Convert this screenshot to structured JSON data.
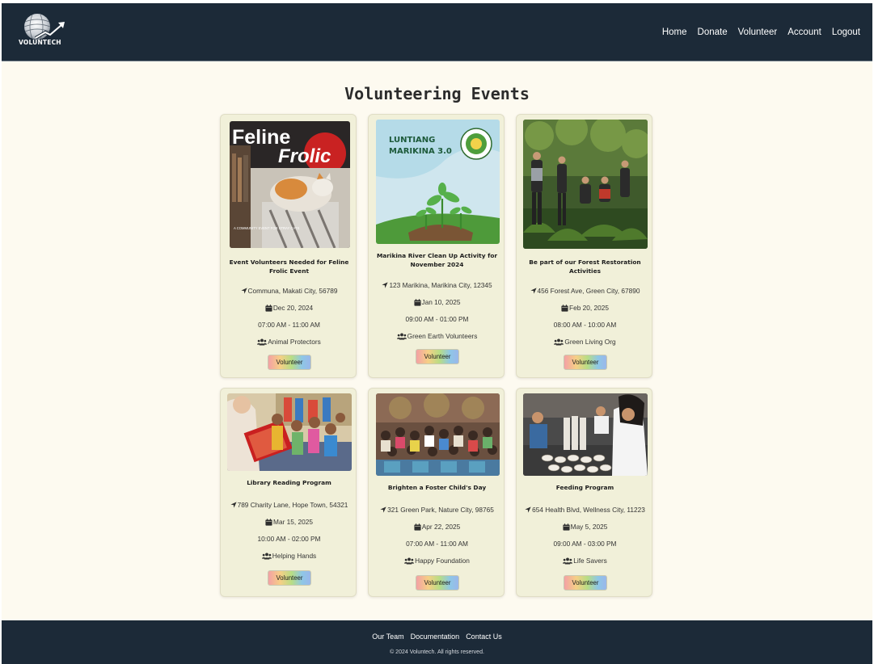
{
  "brand": {
    "logo_text": "VOLUNTECH"
  },
  "nav": {
    "items": [
      {
        "label": "Home"
      },
      {
        "label": "Donate"
      },
      {
        "label": "Volunteer"
      },
      {
        "label": "Account"
      },
      {
        "label": "Logout"
      }
    ]
  },
  "page": {
    "title": "Volunteering Events"
  },
  "events": [
    {
      "image_title_line1": "Feline",
      "image_title_line2": "Frolic",
      "image_caption": "A COMMUNITY EVENT FOR STRAY CATS",
      "title": "Event Volunteers Needed for Feline Frolic Event",
      "location": "Communa, Makati City, 56789",
      "date": "Dec 20, 2024",
      "time": "07:00 AM - 11:00 AM",
      "organizer": "Animal Protectors",
      "button_label": "Volunteer"
    },
    {
      "image_title_line1": "LUNTIANG",
      "image_title_line2": "MARIKINA 3.0",
      "title": "Marikina River Clean Up Activity for November 2024",
      "location": "123 Marikina, Marikina City, 12345",
      "date": "Jan 10, 2025",
      "time": "09:00 AM - 01:00 PM",
      "organizer": "Green Earth Volunteers",
      "button_label": "Volunteer"
    },
    {
      "title": "Be part of our Forest Restoration Activities",
      "location": "456 Forest Ave, Green City, 67890",
      "date": "Feb 20, 2025",
      "time": "08:00 AM - 10:00 AM",
      "organizer": "Green Living Org",
      "button_label": "Volunteer"
    },
    {
      "title": "Library Reading Program",
      "location": "789 Charity Lane, Hope Town, 54321",
      "date": "Mar 15, 2025",
      "time": "10:00 AM - 02:00 PM",
      "organizer": "Helping Hands",
      "button_label": "Volunteer"
    },
    {
      "title": "Brighten a Foster Child's Day",
      "location": "321 Green Park, Nature City, 98765",
      "date": "Apr 22, 2025",
      "time": "07:00 AM - 11:00 AM",
      "organizer": "Happy Foundation",
      "button_label": "Volunteer"
    },
    {
      "title": "Feeding Program",
      "location": "654 Health Blvd, Wellness City, 11223",
      "date": "May 5, 2025",
      "time": "09:00 AM - 03:00 PM",
      "organizer": "Life Savers",
      "button_label": "Volunteer"
    }
  ],
  "footer": {
    "links": [
      {
        "label": "Our Team"
      },
      {
        "label": "Documentation"
      },
      {
        "label": "Contact Us"
      }
    ],
    "copyright": "© 2024 Voluntech. All rights reserved."
  },
  "colors": {
    "navbar": "#1c2a38",
    "page_background": "#fdfaf0",
    "card_background": "#f1f0d9",
    "button_gradient": [
      "#f3a1a4",
      "#f6cf86",
      "#b8dd84",
      "#8ec7e6",
      "#9ab7ea"
    ]
  },
  "icons": {
    "location": "location-arrow-icon",
    "date": "calendar-icon",
    "organizer": "users-icon"
  }
}
